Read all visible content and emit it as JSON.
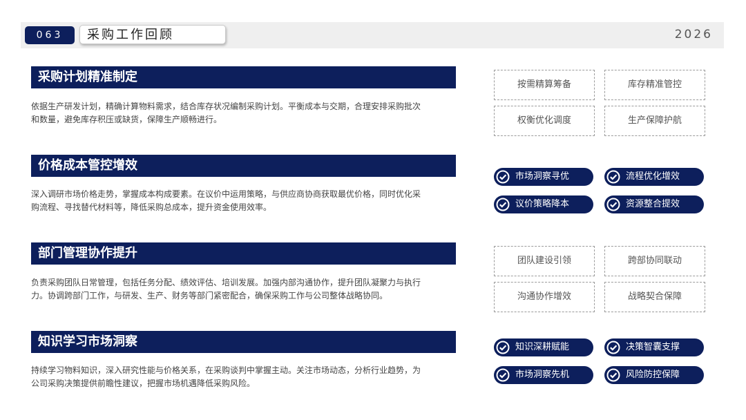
{
  "header": {
    "page_number": "063",
    "title": "采购工作回顾",
    "year": "2026"
  },
  "sections": [
    {
      "heading": "采购计划精准制定",
      "body": "依据生产研发计划，精确计算物料需求，结合库存状况编制采购计划。平衡成本与交期，合理安排采购批次和数量，避免库存积压或缺货，保障生产顺畅进行。"
    },
    {
      "heading": "价格成本管控增效",
      "body": "深入调研市场价格走势，掌握成本构成要素。在议价中运用策略，与供应商协商获取最优价格，同时优化采购流程、寻找替代材料等，降低采购总成本，提升资金使用效率。"
    },
    {
      "heading": "部门管理协作提升",
      "body": "负责采购团队日常管理，包括任务分配、绩效评估、培训发展。加强内部沟通协作，提升团队凝聚力与执行力。协调跨部门工作，与研发、生产、财务等部门紧密配合，确保采购工作与公司整体战略协同。"
    },
    {
      "heading": "知识学习市场洞察",
      "body": "持续学习物料知识，深入研究性能与价格关系，在采购谈判中掌握主动。关注市场动态，分析行业趋势，为公司采购决策提供前瞻性建议，把握市场机遇降低采购风险。"
    }
  ],
  "tags": {
    "group1": [
      "按需精算筹备",
      "库存精准管控",
      "权衡优化调度",
      "生产保障护航"
    ],
    "group2": [
      "市场洞察寻优",
      "流程优化增效",
      "议价策略降本",
      "资源整合提效"
    ],
    "group3": [
      "团队建设引领",
      "跨部协同联动",
      "沟通协作增效",
      "战略契合保障"
    ],
    "group4": [
      "知识深耕赋能",
      "决策智囊支撑",
      "市场洞察先机",
      "风险防控保障"
    ]
  },
  "icons": {
    "pill_icon": "check-circle-icon"
  },
  "colors": {
    "primary": "#0d1f5c",
    "topbar": "#efefef"
  }
}
